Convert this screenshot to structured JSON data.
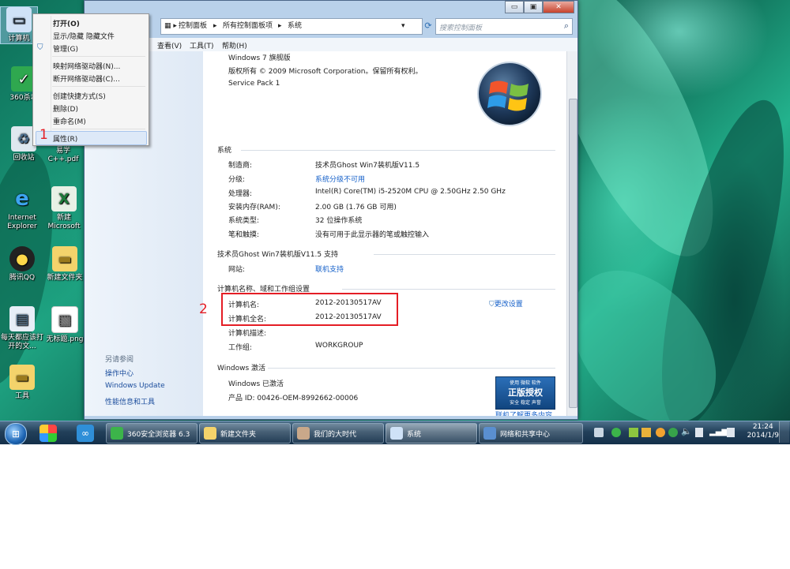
{
  "desktop": {
    "icons": [
      {
        "label": "计算机",
        "icon": "computer-icon"
      },
      {
        "label": "360杀毒",
        "icon": "antivirus-shield-icon"
      },
      {
        "label": "回收站",
        "icon": "recycle-bin-icon"
      },
      {
        "label": "易学 C++.pdf",
        "icon": "pdf-file-icon"
      },
      {
        "label": "Internet Explorer",
        "icon": "ie-icon"
      },
      {
        "label": "新建 Microsoft",
        "icon": "excel-icon"
      },
      {
        "label": "腾讯QQ",
        "icon": "qq-icon"
      },
      {
        "label": "新建文件夹",
        "icon": "folder-icon"
      },
      {
        "label": "每天都应该打开的文...",
        "icon": "document-icon"
      },
      {
        "label": "无标题.png",
        "icon": "image-file-icon"
      },
      {
        "label": "工具",
        "icon": "folder-icon"
      }
    ]
  },
  "context_menu": {
    "items": [
      {
        "label": "打开(O)"
      },
      {
        "label": "显示/隐藏 隐藏文件"
      },
      {
        "label": "管理(G)",
        "icon": "uac-shield-icon"
      },
      {
        "label": "映射网络驱动器(N)..."
      },
      {
        "label": "断开网络驱动器(C)..."
      },
      {
        "label": "创建快捷方式(S)"
      },
      {
        "label": "删除(D)"
      },
      {
        "label": "重命名(M)"
      },
      {
        "label": "属性(R)"
      }
    ]
  },
  "window": {
    "breadcrumb": [
      "控制面板",
      "所有控制面板项",
      "系统"
    ],
    "search_placeholder": "搜索控制面板",
    "title_buttons": {
      "minimize": "▭",
      "maximize": "▣",
      "close": "✕"
    },
    "menubar": [
      "查看(V)",
      "工具(T)",
      "帮助(H)"
    ],
    "see_also": {
      "heading": "另请参阅",
      "links": [
        "操作中心",
        "Windows Update",
        "性能信息和工具"
      ]
    },
    "edition": {
      "name": "Windows 7 旗舰版",
      "copyright": "版权所有 © 2009 Microsoft Corporation。保留所有权利。",
      "service_pack": "Service Pack 1"
    },
    "system": {
      "heading": "系统",
      "rows": [
        {
          "label": "制造商:",
          "value": "技术员Ghost Win7装机版V11.5"
        },
        {
          "label": "分级:",
          "value": "系统分级不可用"
        },
        {
          "label": "处理器:",
          "value": "Intel(R) Core(TM) i5-2520M CPU @ 2.50GHz   2.50 GHz"
        },
        {
          "label": "安装内存(RAM):",
          "value": "2.00 GB (1.76 GB 可用)"
        },
        {
          "label": "系统类型:",
          "value": "32 位操作系统"
        },
        {
          "label": "笔和触摸:",
          "value": "没有可用于此显示器的笔或触控输入"
        }
      ]
    },
    "support": {
      "heading": "技术员Ghost Win7装机版V11.5 支持",
      "rows": [
        {
          "label": "网站:",
          "value": "联机支持"
        }
      ]
    },
    "computer": {
      "heading": "计算机名称、域和工作组设置",
      "change_settings": "更改设置",
      "rows": [
        {
          "label": "计算机名:",
          "value": "2012-20130517AV"
        },
        {
          "label": "计算机全名:",
          "value": "2012-20130517AV"
        },
        {
          "label": "计算机描述:",
          "value": ""
        },
        {
          "label": "工作组:",
          "value": "WORKGROUP"
        }
      ]
    },
    "activation": {
      "heading": "Windows 激活",
      "status": "Windows 已激活",
      "product_id": "产品 ID: 00426-OEM-8992662-00006",
      "badge_small": "使用 微软 软件",
      "badge_main": "正版授权",
      "badge_sub": "安全 稳定 声誉",
      "learn_more": "联机了解更多内容..."
    }
  },
  "taskbar": {
    "buttons": [
      {
        "label": "360安全浏览器 6.3",
        "icon": "browser-360-icon"
      },
      {
        "label": "新建文件夹",
        "icon": "folder-icon"
      },
      {
        "label": "我们的大时代",
        "icon": "people-icon"
      },
      {
        "label": "系统",
        "icon": "system-computer-icon"
      },
      {
        "label": "网络和共享中心",
        "icon": "network-icon"
      }
    ],
    "clock_time": "21:24",
    "clock_date": "2014/1/9"
  },
  "annotations": {
    "step1": "1",
    "step2": "2"
  },
  "colors": {
    "annotation_red": "#e41d25",
    "link_blue": "#1560c9",
    "taskbar": "#22405a"
  }
}
